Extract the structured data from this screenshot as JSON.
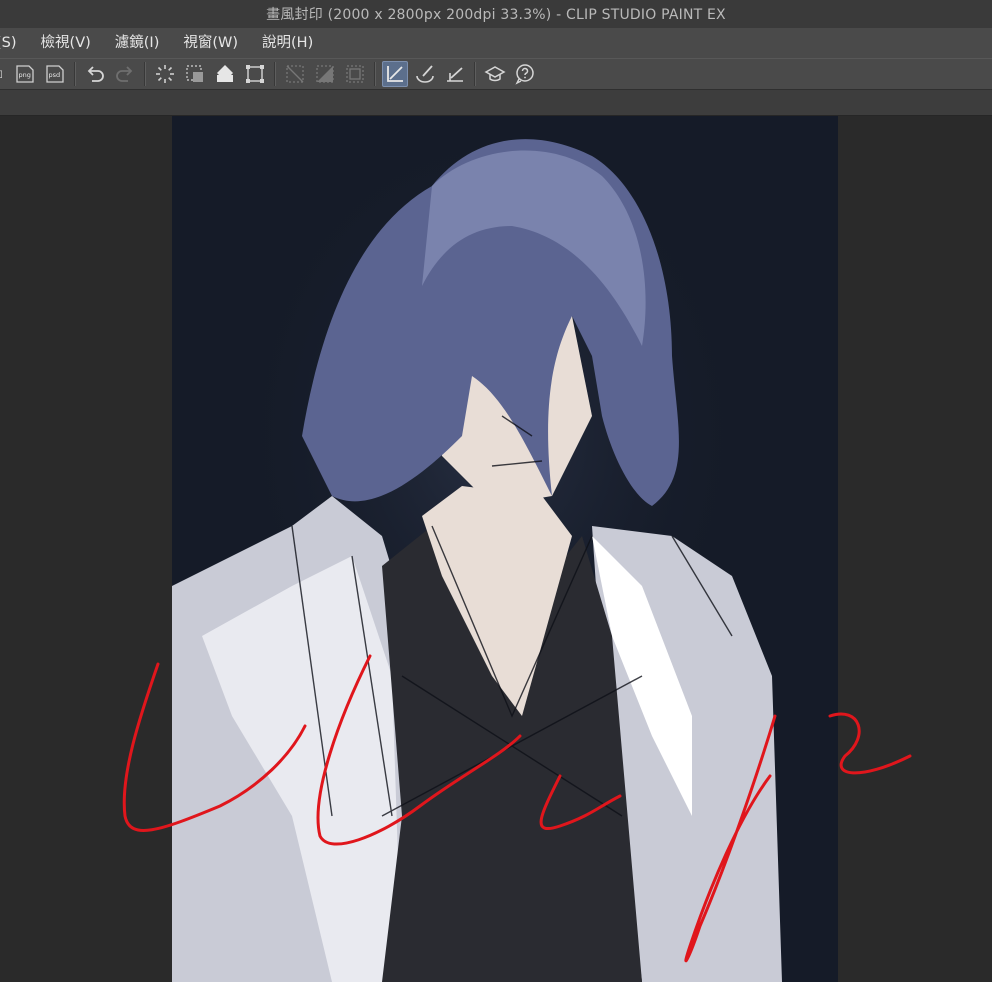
{
  "window": {
    "title": "畫風封印 (2000 x 2800px 200dpi 33.3%)  - CLIP STUDIO PAINT EX"
  },
  "menu": {
    "items": [
      {
        "label": "(S)"
      },
      {
        "label": "檢視(V)"
      },
      {
        "label": "濾鏡(I)"
      },
      {
        "label": "視窗(W)"
      },
      {
        "label": "說明(H)"
      }
    ]
  },
  "toolbar": {
    "buttons": [
      {
        "icon": "export-jpg-icon"
      },
      {
        "icon": "export-png-icon",
        "label": "png"
      },
      {
        "icon": "export-psd-icon",
        "label": "psd"
      },
      {
        "icon": "undo-icon"
      },
      {
        "icon": "redo-icon"
      },
      {
        "icon": "clear-selection-icon"
      },
      {
        "icon": "select-all-icon"
      },
      {
        "icon": "fill-icon"
      },
      {
        "icon": "transform-icon"
      },
      {
        "icon": "hide-selection-icon"
      },
      {
        "icon": "invert-selection-icon"
      },
      {
        "icon": "crop-icon"
      },
      {
        "icon": "snap-to-ruler-icon",
        "active": true
      },
      {
        "icon": "snap-to-special-ruler-icon"
      },
      {
        "icon": "snap-to-grid-icon"
      },
      {
        "icon": "tutorial-icon"
      },
      {
        "icon": "help-icon"
      }
    ]
  },
  "colors": {
    "canvas_bg": "#151b28",
    "hair": "#5b6491",
    "jacket": "#c9cbd6",
    "shirt": "#2a2b31",
    "skin": "#e8ddd6",
    "signature": "#e0161c",
    "active_button": "#5c6f8c"
  }
}
